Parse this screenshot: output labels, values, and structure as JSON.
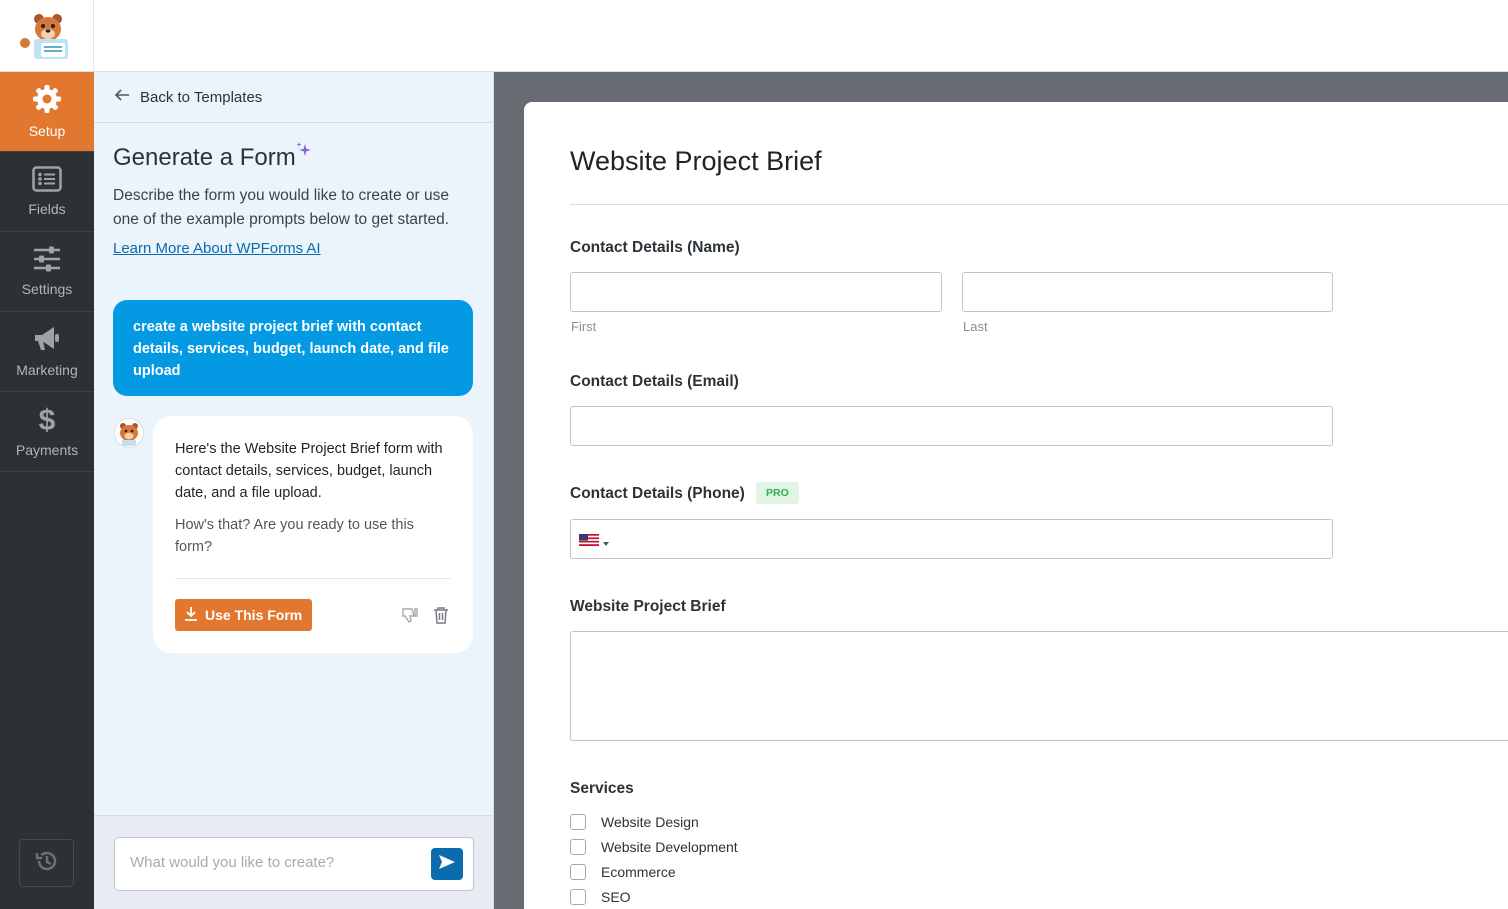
{
  "nav": {
    "items": [
      {
        "label": "Setup",
        "icon": "gear-icon"
      },
      {
        "label": "Fields",
        "icon": "fields-list-icon"
      },
      {
        "label": "Settings",
        "icon": "sliders-icon"
      },
      {
        "label": "Marketing",
        "icon": "megaphone-icon"
      },
      {
        "label": "Payments",
        "icon": "dollar-icon"
      }
    ],
    "history_icon": "history-icon"
  },
  "panel": {
    "back_label": "Back to Templates",
    "title": "Generate a Form",
    "description": "Describe the form you would like to create or use one of the example prompts below to get started.",
    "learn_more": "Learn More About WPForms AI",
    "user_message": "create a website project brief with contact details, services, budget, launch date, and file upload",
    "bot_message_1": "Here's the Website Project Brief form with contact details, services, budget, launch date, and a file upload.",
    "bot_message_2": "How's that? Are you ready to use this form?",
    "use_button": "Use This Form",
    "prompt_placeholder": "What would you like to create?"
  },
  "form": {
    "title": "Website Project Brief",
    "name_label": "Contact Details (Name)",
    "first_sublabel": "First",
    "last_sublabel": "Last",
    "email_label": "Contact Details (Email)",
    "phone_label": "Contact Details (Phone)",
    "pro_badge": "PRO",
    "brief_label": "Website Project Brief",
    "services_label": "Services",
    "services": [
      "Website Design",
      "Website Development",
      "Ecommerce",
      "SEO"
    ]
  },
  "colors": {
    "accent_orange": "#e27730",
    "nav_bg": "#2d3135",
    "panel_bg": "#ebf3fb",
    "user_bubble": "#0399e3",
    "link_blue": "#0a6bae",
    "preview_bg": "#676c72"
  }
}
